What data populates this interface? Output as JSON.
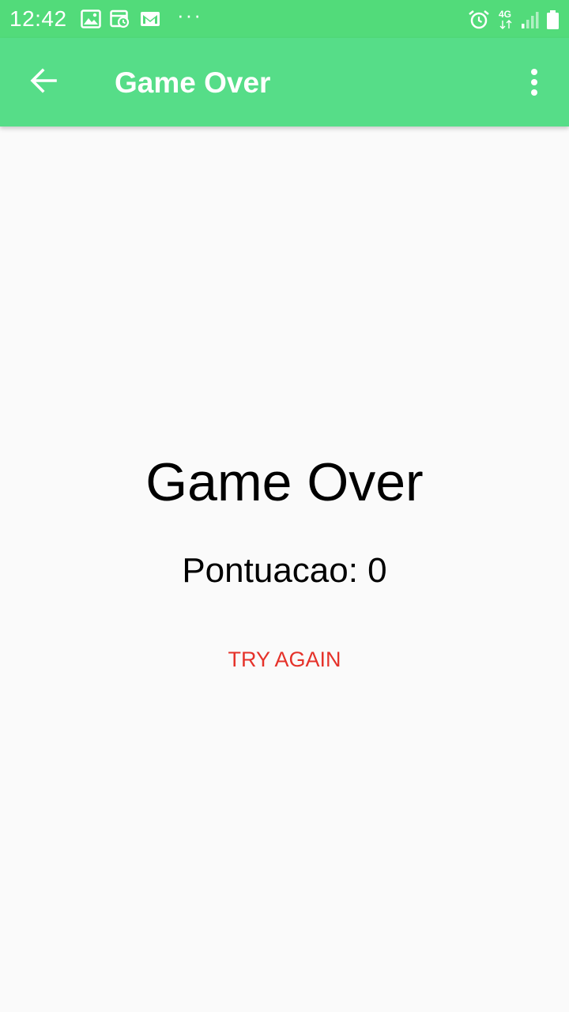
{
  "status_bar": {
    "time": "12:42",
    "notification_icons": [
      "image-icon",
      "calendar-clock-icon",
      "gmail-icon"
    ],
    "more_indicator": "···",
    "system_icons": [
      "alarm-icon",
      "4g-icon",
      "signal-icon",
      "battery-icon"
    ],
    "network_label": "4G",
    "color": "#52db7a"
  },
  "app_bar": {
    "title": "Game Over",
    "back_icon": "back-arrow-icon",
    "menu_icon": "more-vert-icon",
    "color": "#56dd88"
  },
  "main": {
    "heading": "Game Over",
    "score_text": "Pontuacao: 0",
    "try_again_label": "TRY AGAIN",
    "accent_color": "#e5322a"
  }
}
